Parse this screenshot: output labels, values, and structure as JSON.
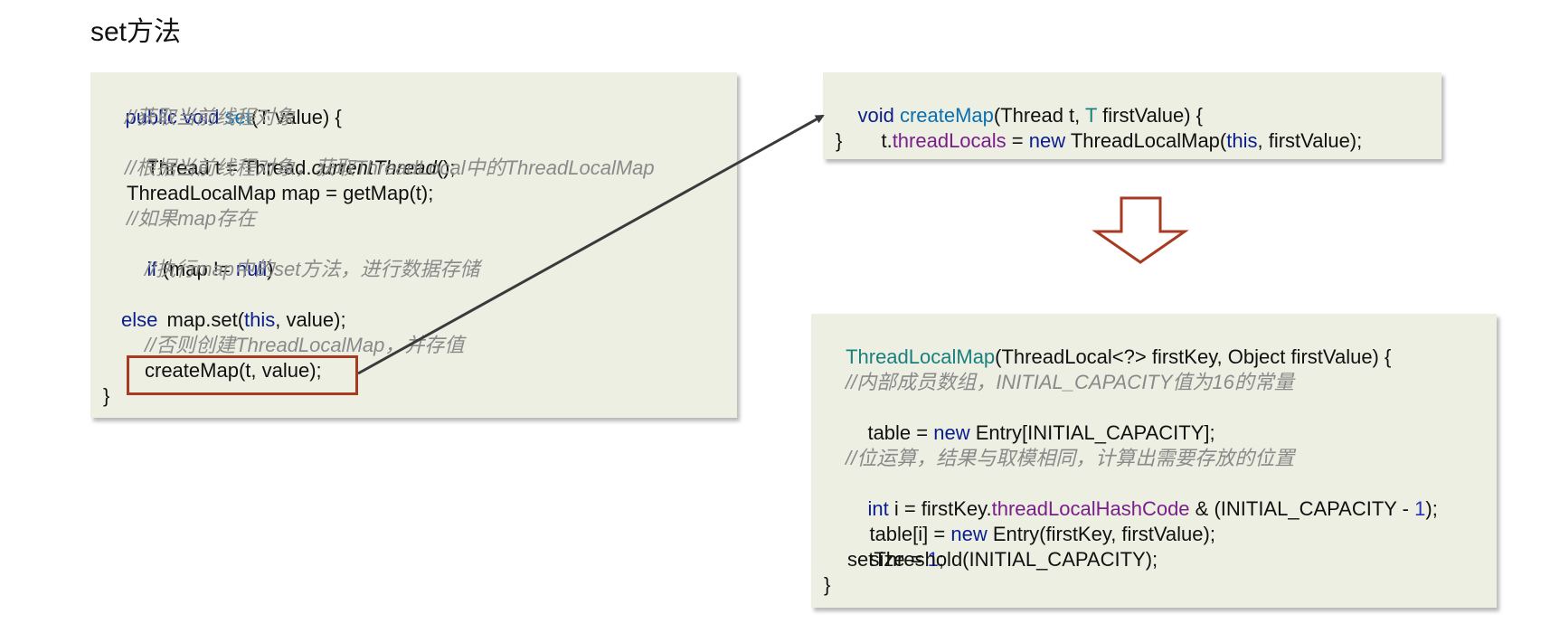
{
  "title": "set方法",
  "colors": {
    "panel_bg": "#ecefe2",
    "keyword": "#0b1e8f",
    "method": "#0b6fb0",
    "type": "#1a7f7f",
    "field": "#7a1f8a",
    "comment": "#8a8a8a",
    "highlight": "#a83a22",
    "arrow": "#3a3a3a"
  },
  "set_code": {
    "l1_kw": "public void ",
    "l1_fn": "set",
    "l1_rest": "(T value) {",
    "c1": "//获取当前线程对象",
    "l2_a": "Thread t = Thread.",
    "l2_it": "currentThread",
    "l2_b": "();",
    "c2": "//根据当前线程对象，获取ThreadLocal中的ThreadLocalMap",
    "l3": "ThreadLocalMap map = getMap(t);",
    "c3": "//如果map存在",
    "l4_kw": "if",
    "l4_a": " (map != ",
    "l4_null": "null",
    "l4_b": ")",
    "c4": "//执行map中的set方法，进行数据存储",
    "l5_a": "map.set(",
    "l5_this": "this",
    "l5_b": ", value);",
    "l6_kw": "else",
    "c5": "//否则创建ThreadLocalMap，并存值",
    "l7": "createMap(t, value);",
    "close": "}"
  },
  "createmap_code": {
    "l1_kw": "void ",
    "l1_fn": "createMap",
    "l1_a": "(Thread t, ",
    "l1_t": "T",
    "l1_b": " firstValue) {",
    "l2_a": "t.",
    "l2_fld": "threadLocals",
    "l2_b": " = ",
    "l2_new": "new",
    "l2_c": " ThreadLocalMap(",
    "l2_this": "this",
    "l2_d": ", firstValue);",
    "close": "}"
  },
  "ctor_code": {
    "l1_fn": "ThreadLocalMap",
    "l1_rest": "(ThreadLocal<?> firstKey, Object firstValue) {",
    "c1": "//内部成员数组，INITIAL_CAPACITY值为16的常量",
    "l2_a": "table = ",
    "l2_new": "new",
    "l2_b": " Entry[INITIAL_CAPACITY];",
    "c2": "//位运算，结果与取模相同，计算出需要存放的位置",
    "l3_int": "int",
    "l3_a": " i = firstKey.",
    "l3_fld": "threadLocalHashCode",
    "l3_b": " & (INITIAL_CAPACITY - ",
    "l3_num": "1",
    "l3_c": ");",
    "l4_a": "table[i] = ",
    "l4_new": "new",
    "l4_b": " Entry(firstKey, firstValue);",
    "l5_a": "size = ",
    "l5_num": "1",
    "l5_b": ";",
    "l6": "setThreshold(INITIAL_CAPACITY);",
    "close": "}"
  }
}
